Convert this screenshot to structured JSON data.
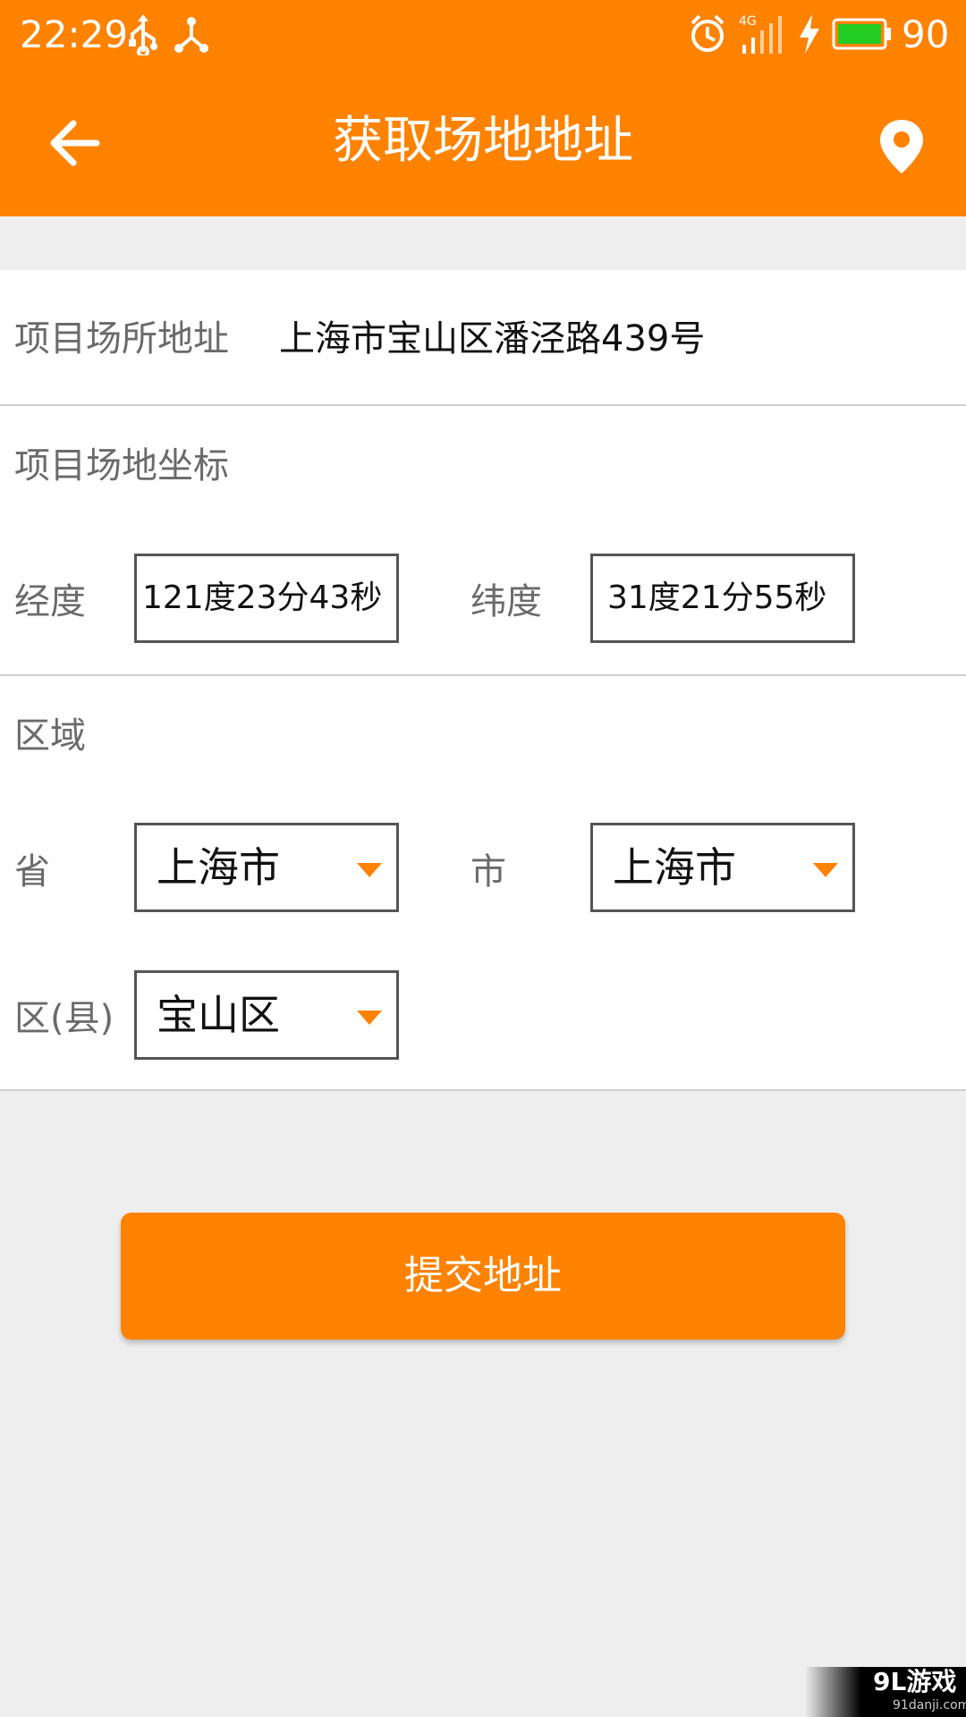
{
  "status_bar": {
    "time": "22:29",
    "network": "4G",
    "battery": "90",
    "battery_color": "#22cc22",
    "icons": [
      "usb-icon",
      "share-network-icon",
      "alarm-icon",
      "signal-icon",
      "charging-icon",
      "battery-icon"
    ]
  },
  "toolbar": {
    "title": "获取场地地址",
    "back_icon": "back-arrow-icon",
    "location_icon": "location-pin-icon"
  },
  "form": {
    "site_address": {
      "label": "项目场所地址",
      "value": "上海市宝山区潘泾路439号"
    },
    "coordinates": {
      "section_label": "项目场地坐标",
      "longitude_label": "经度",
      "longitude_value": "121度23分43秒",
      "latitude_label": "纬度",
      "latitude_value": "31度21分55秒"
    },
    "region": {
      "section_label": "区域",
      "province_label": "省",
      "province_value": "上海市",
      "city_label": "市",
      "city_value": "上海市",
      "district_label": "区(县)",
      "district_value": "宝山区"
    }
  },
  "submit_button": {
    "label": "提交地址"
  },
  "watermark": {
    "logo": "9L游戏",
    "url": "91danji.com"
  },
  "colors": {
    "accent": "#ff8200",
    "background": "#eeeeee",
    "label": "#6a6a6a"
  }
}
